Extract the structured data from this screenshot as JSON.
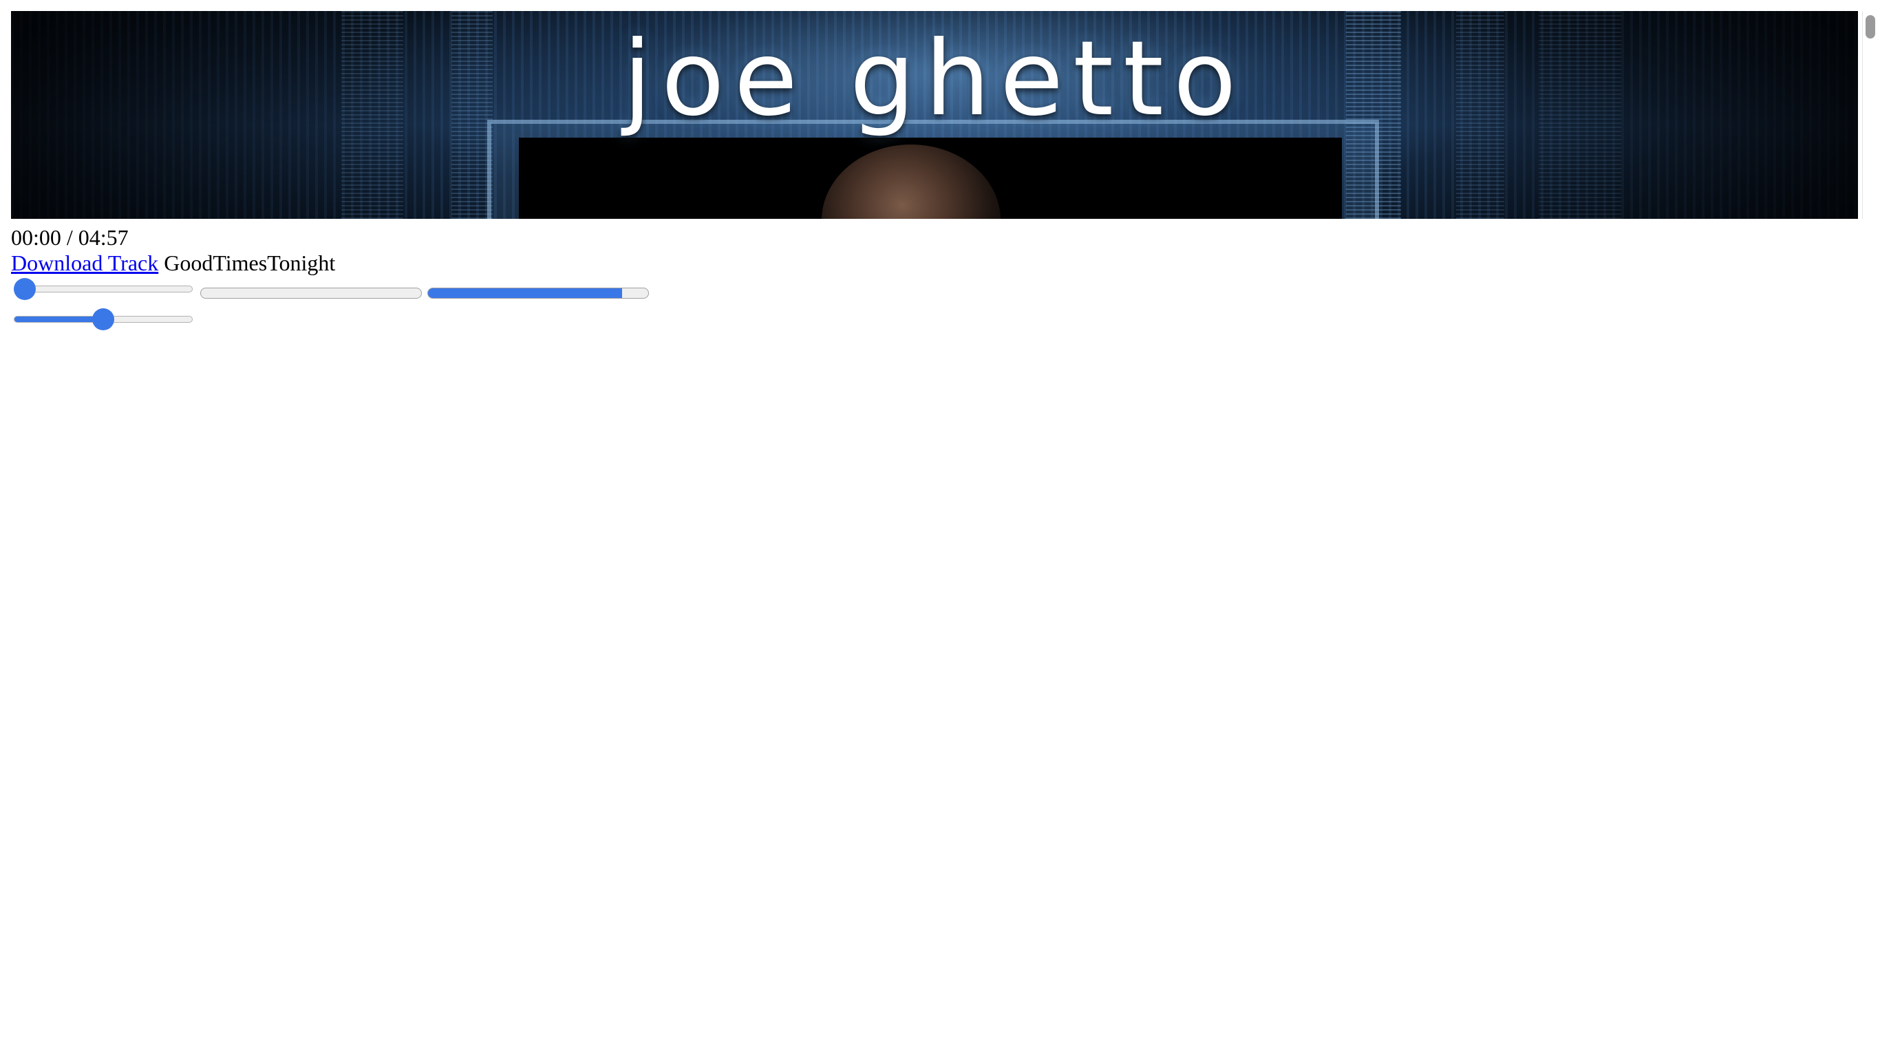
{
  "banner": {
    "artist_name": "joe ghetto"
  },
  "player": {
    "time_display": "00:00 / 04:57",
    "download_label": "Download Track",
    "track_title": "GoodTimesTonight",
    "seek_fraction": 0.0,
    "volume_fraction": 0.5,
    "progress_bars": [
      {
        "fraction": 0.0
      },
      {
        "fraction": 0.88
      }
    ]
  },
  "colors": {
    "accent": "#3b78e7",
    "link": "#0000ee",
    "track_bg": "#efefef"
  }
}
